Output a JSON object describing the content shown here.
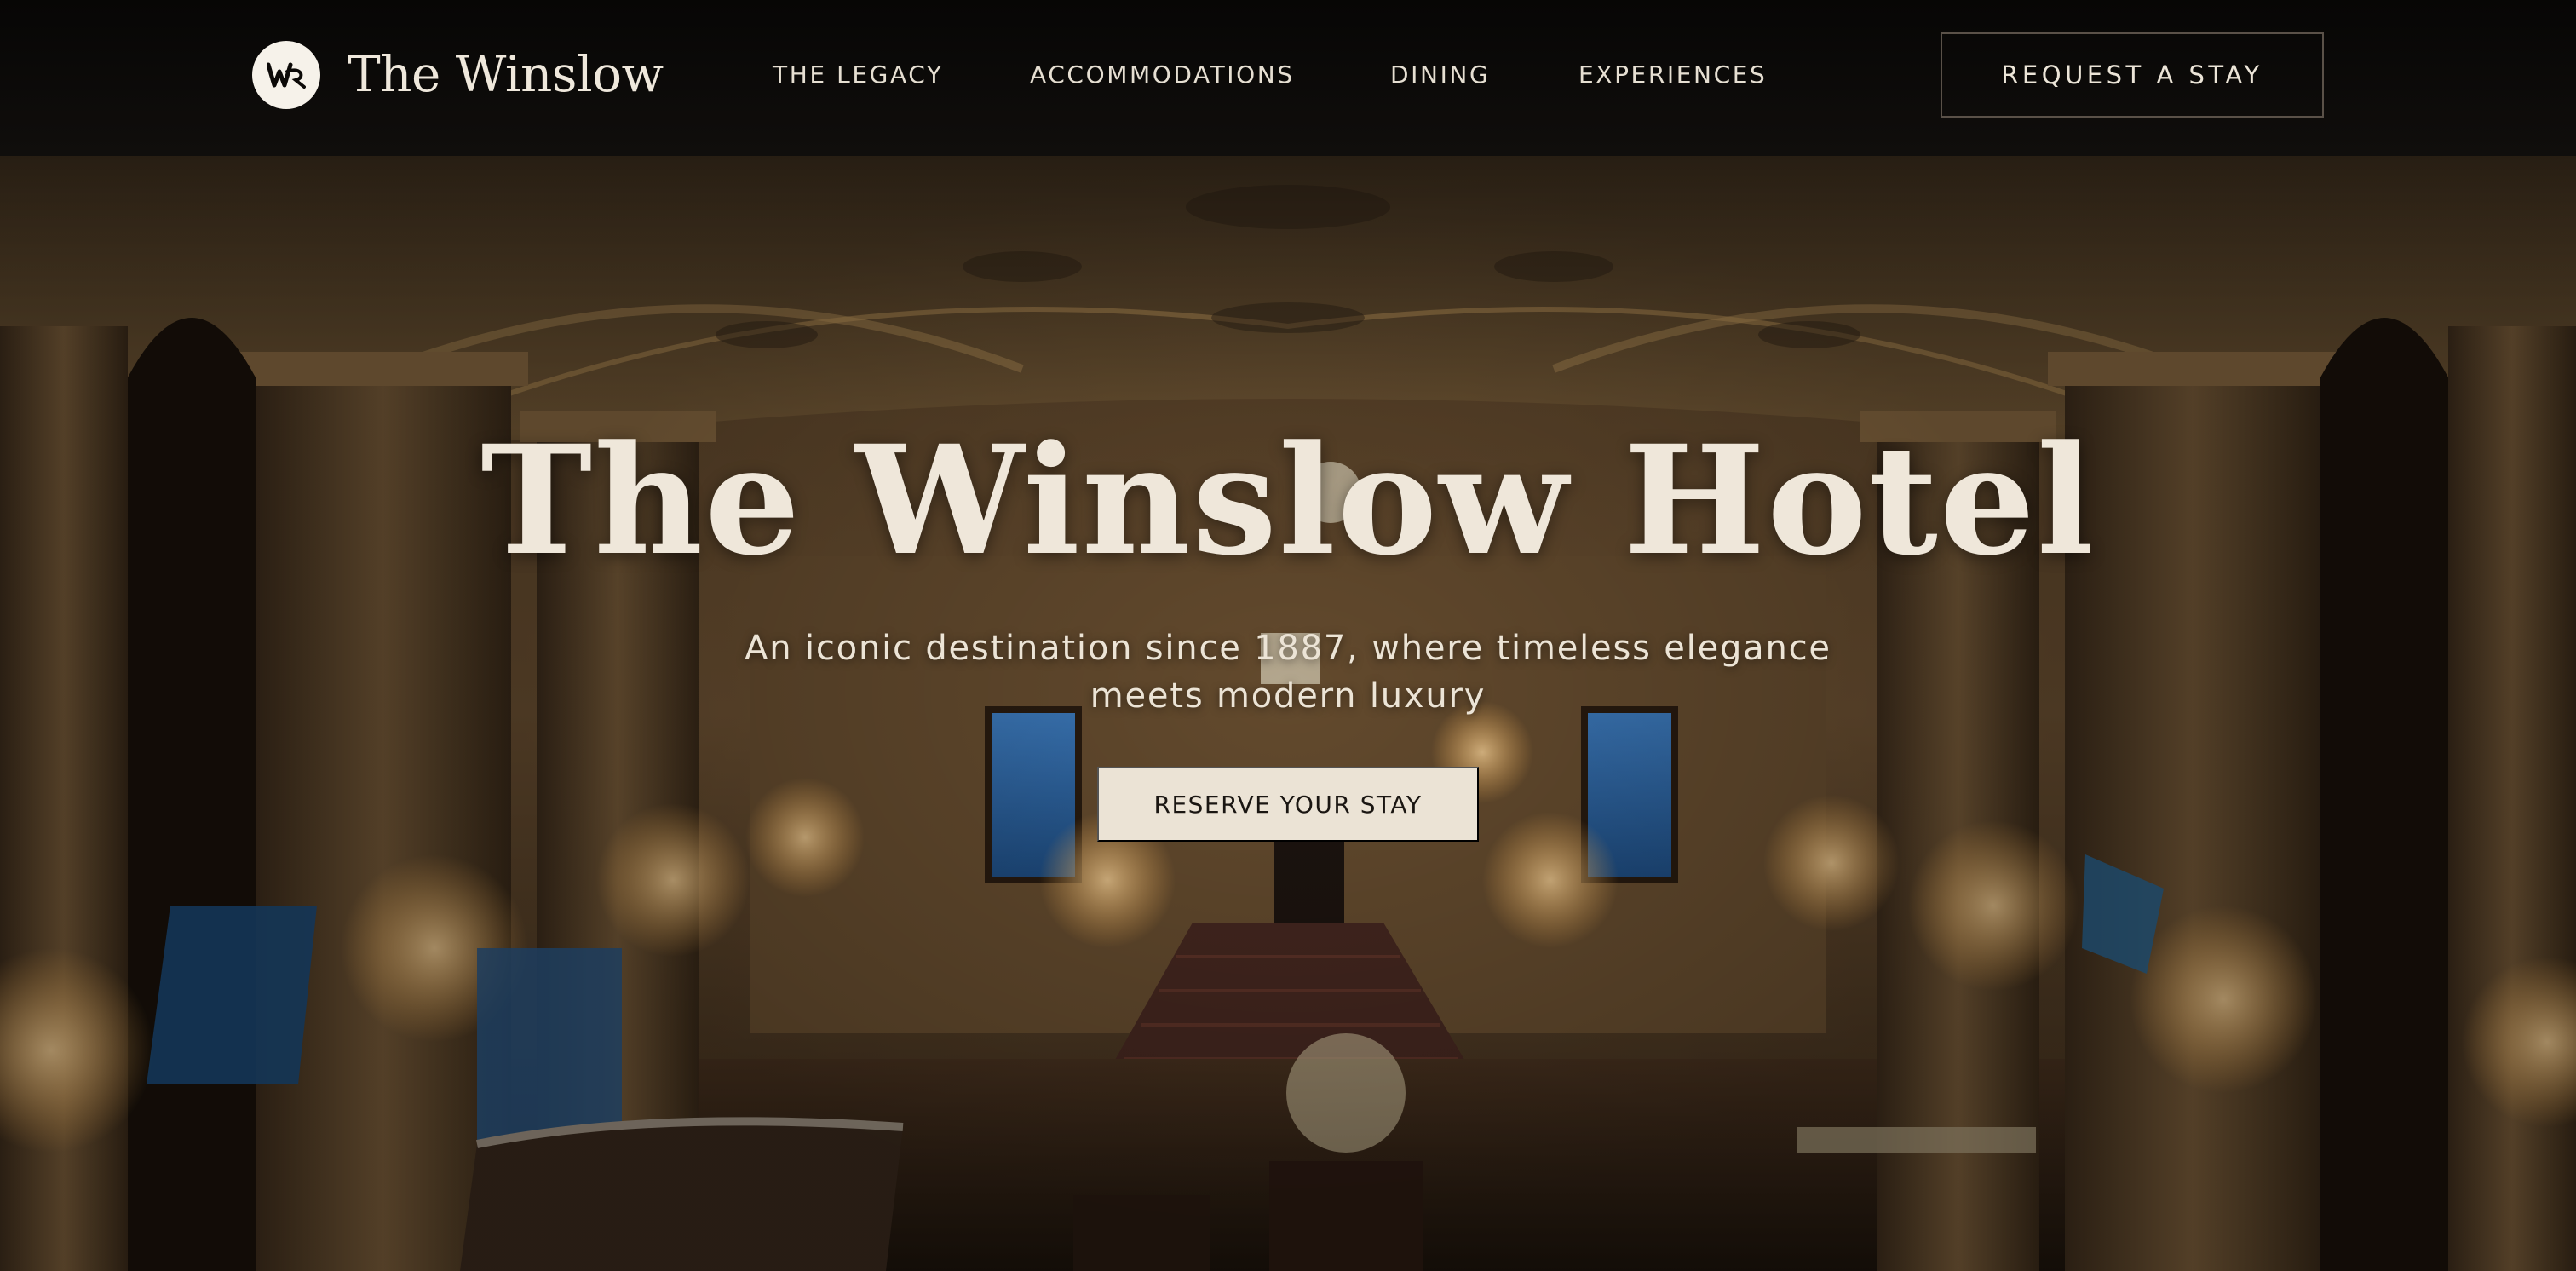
{
  "nav": {
    "brand": "The Winslow",
    "logo_mark": "W",
    "links": [
      {
        "label": "THE LEGACY"
      },
      {
        "label": "ACCOMMODATIONS"
      },
      {
        "label": "DINING"
      },
      {
        "label": "EXPERIENCES"
      }
    ],
    "cta_label": "REQUEST A STAY"
  },
  "hero": {
    "title": "The Winslow Hotel",
    "subtitle": "An iconic destination since 1887, where timeless elegance meets modern luxury",
    "cta_label": "RESERVE YOUR STAY",
    "background_image": "grand-hotel-lobby-photo"
  },
  "colors": {
    "nav_bg": "#0c0a08",
    "text_light": "#efe7da",
    "cta_bg": "#ebe3d5",
    "cta_text": "#1a1612",
    "warm_gold": "#b8894a"
  }
}
